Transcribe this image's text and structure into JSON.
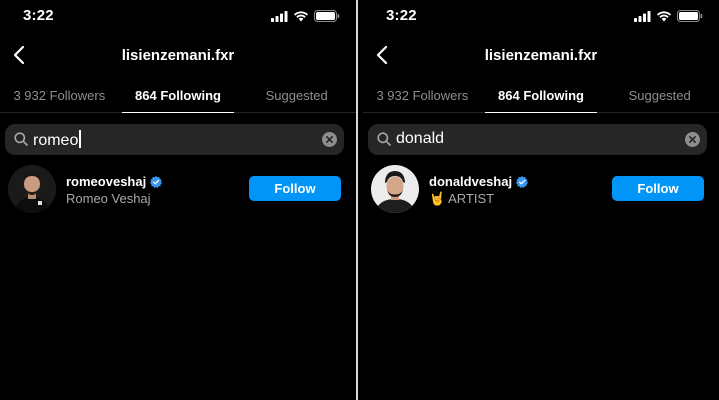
{
  "colors": {
    "accent": "#0095f6",
    "background": "#000000",
    "search_bg": "#262626",
    "muted_text": "#8e8e8e",
    "verified": "#3897f0"
  },
  "panels": [
    {
      "status": {
        "time": "3:22"
      },
      "nav": {
        "title": "lisienzemani.fxr",
        "back_icon": "chevron-left-icon"
      },
      "tabs": [
        "3 932 Followers",
        "864 Following",
        "Suggested"
      ],
      "active_tab": 1,
      "search": {
        "value": "romeo"
      },
      "result": {
        "username": "romeoveshaj",
        "subtitle": "Romeo Veshaj",
        "verified": true,
        "button": "Follow"
      }
    },
    {
      "status": {
        "time": "3:22"
      },
      "nav": {
        "title": "lisienzemani.fxr",
        "back_icon": "chevron-left-icon"
      },
      "tabs": [
        "3 932 Followers",
        "864 Following",
        "Suggested"
      ],
      "active_tab": 1,
      "search": {
        "value": "donald"
      },
      "result": {
        "username": "donaldveshaj",
        "subtitle_emoji": "🤘",
        "subtitle": "ARTIST",
        "verified": true,
        "button": "Follow"
      }
    }
  ]
}
